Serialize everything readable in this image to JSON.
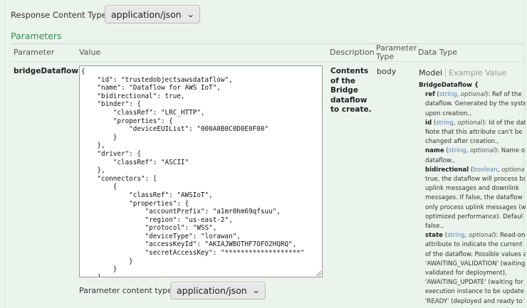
{
  "response": {
    "label": "Response Content Type",
    "selected": "application/json"
  },
  "parameters": {
    "title": "Parameters",
    "headers": {
      "parameter": "Parameter",
      "value": "Value",
      "description": "Description",
      "parameter_type_line1": "Parameter",
      "parameter_type_line2": "Type",
      "data_type": "Data Type"
    },
    "row": {
      "name": "bridgeDataflow",
      "value_lines": [
        "{",
        "    \"id\": \"trustedobjectsawsdataflow\",",
        "    \"name\": \"Dataflow for AWS IoT\",",
        "    \"bidirectional\": true,",
        "    \"binder\": {",
        "        \"classRef\": \"LRC_HTTP\",",
        "        \"properties\": {",
        "            \"deviceEUIList\": \"000A0B0C0D0E0F00\"",
        "        }",
        "    },",
        "    \"driver\": {",
        "        \"classRef\": \"ASCII\"",
        "    },",
        "    \"connectors\": [",
        "        {",
        "            \"classRef\": \"AWSIoT\",",
        "            \"properties\": {",
        "                \"accountPrefix\": \"a1mr0hm69qfsuu\",",
        "                \"region\": \"us-east-2\",",
        "                \"protocol\": \"WSS\",",
        "                \"deviceType\": \"lorawan\",",
        "                \"accessKeyId\": \"AKIAJWBOTHF7OFO2HQRQ\",",
        "                \"secretAccessKey\": \"*******************\"",
        "            }",
        "        }",
        "    ]",
        "}"
      ],
      "content_type_label": "Parameter content type:",
      "content_type_selected": "application/json",
      "description": "Contents of the Bridge dataflow to create.",
      "param_type": "body",
      "data_type_tabs": {
        "model": "Model",
        "example": "Example Value"
      },
      "schema": {
        "title": "BridgeDataflow {",
        "props": [
          {
            "name": "ref",
            "type": "string",
            "opt": "optional",
            "rest": "): Ref of the",
            "desc": [
              "dataflow. Generated by the syste",
              "upon creation.,"
            ]
          },
          {
            "name": "id",
            "type": "string",
            "opt": "optional",
            "rest": "): Id of the data",
            "desc": [
              "Note that this attribute can't be",
              "changed after creation.,"
            ]
          },
          {
            "name": "name",
            "type": "string",
            "opt": "optional",
            "rest": "): Name o",
            "desc": [
              "dataflow.,"
            ]
          },
          {
            "name": "bidirectional",
            "type": "boolean",
            "opt": "optiona",
            "rest": "",
            "desc": [
              "true, the dataflow will process bo",
              "uplink messages and downlink",
              "messages. If false, the dataflow",
              "only process uplink messages (w",
              "optimized performance). Defaul",
              "false.,"
            ]
          },
          {
            "name": "state",
            "type": "string",
            "opt": "optional",
            "rest": "): Read-on",
            "desc": [
              "attribute to indicate the current",
              "of the dataflow. Possible values a",
              "'AWAITING_VALIDATION' (waiting",
              "validated for deployment),",
              "'AWAITING_UPDATE' (waiting for",
              "execution instance to be update",
              "'READY' (deployed and ready to"
            ]
          }
        ]
      }
    }
  },
  "icons": {
    "dropdown": "chevron-down-icon"
  }
}
